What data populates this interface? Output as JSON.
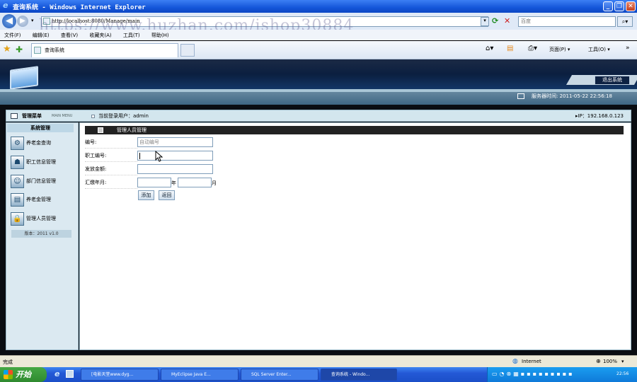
{
  "window": {
    "title": "查询系统 - Windows Internet Explorer",
    "minimize_glyph": "_",
    "maximize_glyph": "❐",
    "close_glyph": "✕"
  },
  "address": {
    "url": "http://localhost:8080/Manage/main",
    "search_placeholder": "百度"
  },
  "watermark": "https://www.huzhan.com/ishop30884",
  "menubar": [
    "文件(F)",
    "编辑(E)",
    "查看(V)",
    "收藏夹(A)",
    "工具(T)",
    "帮助(H)"
  ],
  "tab": {
    "label": "查询系统"
  },
  "command_bar": {
    "page": "页面(P) ▾",
    "tools": "工具(O) ▾"
  },
  "header": {
    "logout_label": "退出系统",
    "server_time": "服务器时间: 2011-05-22 22:56:18"
  },
  "infobar": {
    "menu_title": "管理菜单",
    "menu_subtitle": "MAIN MENU",
    "current_user": "当前登录用户：admin",
    "ip": "▸IP：192.168.0.123"
  },
  "sidebar": {
    "heading": "系统管理",
    "items": [
      {
        "label": "养老金查询",
        "icon": "gear-icon"
      },
      {
        "label": "职工信息管理",
        "icon": "user-doc-icon"
      },
      {
        "label": "部门信息管理",
        "icon": "person-icon"
      },
      {
        "label": "养老金管理",
        "icon": "window-icon"
      },
      {
        "label": "管理人员管理",
        "icon": "lock-user-icon"
      }
    ],
    "version": "版本：2011 v1.0"
  },
  "form": {
    "heading": "管理人员管理",
    "fields": {
      "id_label": "编号:",
      "id_placeholder": "自动编号",
      "emp_label": "职工编号:",
      "emp_value": "",
      "amount_label": "发放金额:",
      "amount_value": "",
      "date_label": "汇缴年月:",
      "year_value": "",
      "year_unit": "年",
      "month_value": "",
      "month_unit": "月"
    },
    "add_label": "添加",
    "back_label": "返回"
  },
  "statusbar": {
    "status": "完成",
    "zone": "Internet",
    "zoom": "100%"
  },
  "taskbar": {
    "start": "开始",
    "tasks": [
      "[电影天堂www.dyg...",
      "MyEclipse Java E...",
      "SQL Server Enter...",
      "查询系统 - Windo..."
    ],
    "clock": "22:56"
  },
  "colors": {
    "titlebar": "#1456d9",
    "banner": "#0b1f40",
    "main_heading_bg": "#222222",
    "sidebar_bg": "#dbe9f1",
    "taskbar": "#2459d6",
    "start_button": "#2f8a2f"
  }
}
